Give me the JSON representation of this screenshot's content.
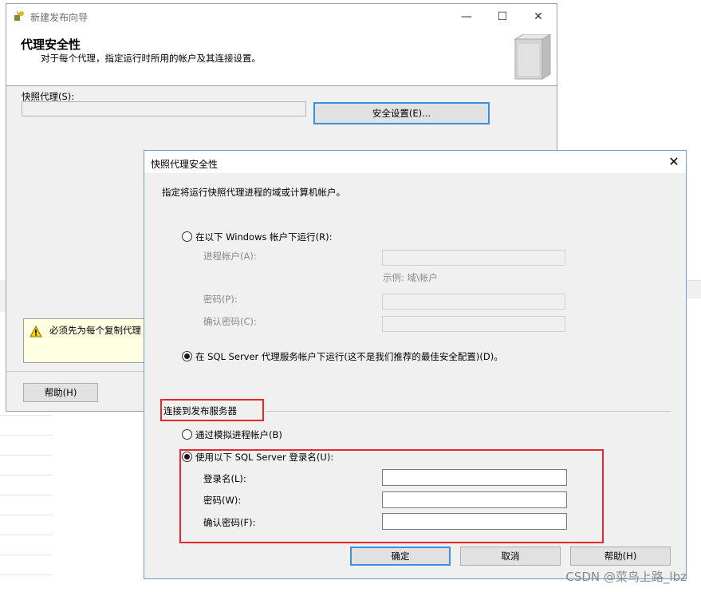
{
  "background_window": {
    "title": "新建发布向导",
    "controls": {
      "minimize": "—",
      "maximize": "☐",
      "close": "✕"
    },
    "heading": "代理安全性",
    "subheading": "对于每个代理，指定运行时所用的帐户及其连接设置。",
    "snapshot_agent_label": "快照代理(S):",
    "snapshot_agent_value": "",
    "security_settings_button": "安全设置(E)...",
    "message_text": "必须先为每个复制代理",
    "help_button": "帮助(H)"
  },
  "dialog": {
    "title": "快照代理安全性",
    "close_glyph": "✕",
    "prompt": "指定将运行快照代理进程的域或计算机帐户。",
    "run_under_windows_account": {
      "label": "在以下 Windows 帐户下运行(R):",
      "selected": false,
      "process_account_label": "进程帐户(A):",
      "process_account_value": "",
      "example_text": "示例: 域\\帐户",
      "password_label": "密码(P):",
      "password_value": "",
      "confirm_password_label": "确认密码(C):",
      "confirm_password_value": ""
    },
    "run_under_sql_agent": {
      "label": "在 SQL Server 代理服务帐户下运行(这不是我们推荐的最佳安全配置)(D)。",
      "selected": true
    },
    "connect_group_title": "连接到发布服务器",
    "impersonate_option": {
      "label": "通过模拟进程帐户(B)",
      "selected": false
    },
    "sql_login_option": {
      "label": "使用以下 SQL Server 登录名(U):",
      "selected": true,
      "login_label": "登录名(L):",
      "login_value": "",
      "password_label": "密码(W):",
      "password_value": "",
      "confirm_password_label": "确认密码(F):",
      "confirm_password_value": ""
    },
    "buttons": {
      "ok": "确定",
      "cancel": "取消",
      "help": "帮助(H)"
    }
  },
  "watermark": "CSDN @菜鸟上路_lbz",
  "colors": {
    "highlight_red": "#e8272b",
    "focus_blue": "#3c8ee0",
    "window_bg": "#f0f0f0"
  }
}
